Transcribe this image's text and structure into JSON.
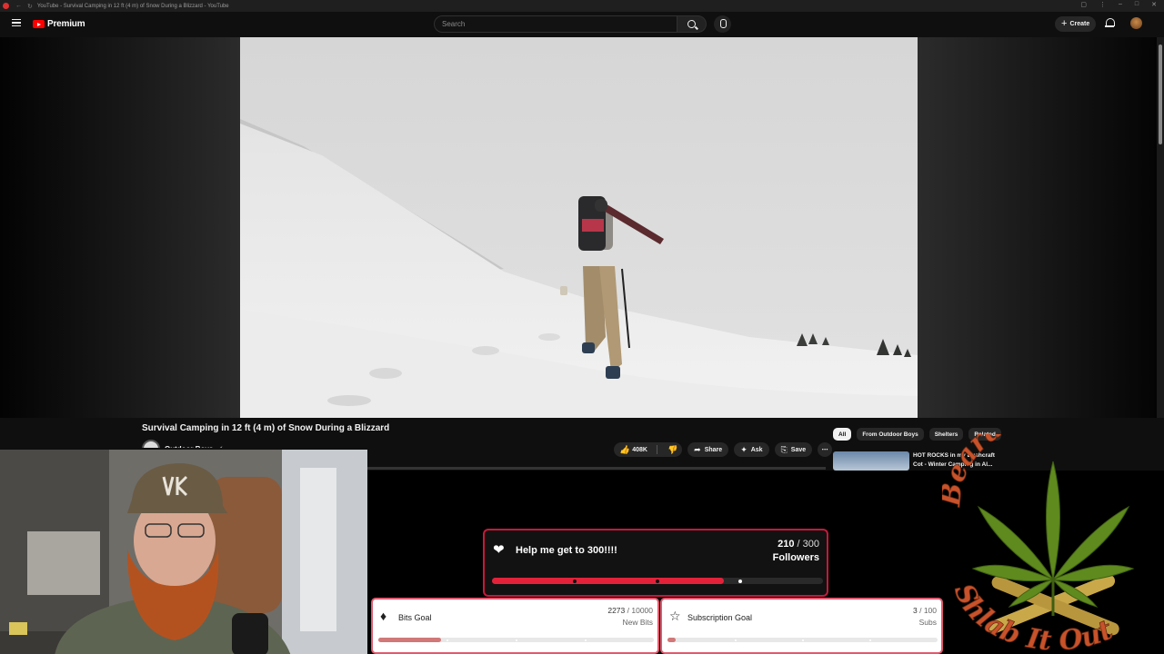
{
  "browser": {
    "tab_title": "YouTube - Survival Camping in 12 ft (4 m) of Snow During a Blizzard - YouTube"
  },
  "header": {
    "logo_text": "Premium",
    "search_placeholder": "Search",
    "create_label": "Create"
  },
  "video": {
    "title": "Survival Camping in 12 ft (4 m) of Snow During a Blizzard",
    "channel": "Outdoor Boys",
    "likes": "408K",
    "share_label": "Share",
    "ask_label": "Ask",
    "save_label": "Save"
  },
  "sidebar": {
    "chips": [
      "All",
      "From Outdoor Boys",
      "Shelters",
      "Related"
    ],
    "recommendation_title": "HOT ROCKS in my Bushcraft Cot - Winter Camping in Al..."
  },
  "follower_goal": {
    "title": "Help me get to 300!!!!",
    "current": "210",
    "target": "300",
    "unit": "Followers",
    "progress": 0.7
  },
  "bits_goal": {
    "title": "Bits Goal",
    "current": "2273",
    "target": "10000",
    "unit": "New Bits",
    "progress": 0.2273
  },
  "sub_goal": {
    "title": "Subscription Goal",
    "current": "3",
    "target": "100",
    "unit": "Subs",
    "progress": 0.03
  },
  "overlay_brand": {
    "line1": "BeardedReds",
    "line2": "Shlab It Out"
  },
  "colors": {
    "youtube_red": "#ff0000",
    "goal_red": "#e3223a",
    "goal_border": "#c9183a"
  }
}
